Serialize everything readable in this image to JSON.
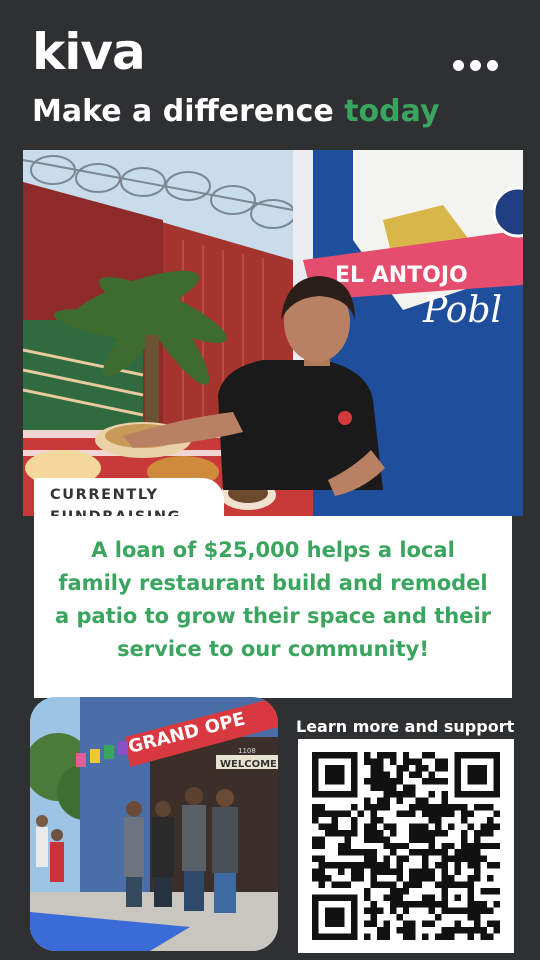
{
  "brand": {
    "logo": "kiva"
  },
  "headline": {
    "prefix": "Make a difference ",
    "accent": "today"
  },
  "hero_photo": {
    "sign_text": "EL ANTOJO",
    "sign_script": "Pobl"
  },
  "fundraising": {
    "badge_line1": "CURRENTLY",
    "badge_line2": "FUNDRAISING",
    "description": "A loan of $25,000 helps a local family restaurant build and remodel a patio to grow their space and their service to our community!"
  },
  "storefront_photo": {
    "banner": "GRAND OPE",
    "welcome": "WELCOME",
    "number": "1108"
  },
  "cta": {
    "label": "Learn more and support"
  },
  "colors": {
    "accent_green": "#3aa55e",
    "background": "#2f3032"
  },
  "icons": {
    "menu": "more-dots-icon",
    "qr": "qr-code-icon"
  }
}
